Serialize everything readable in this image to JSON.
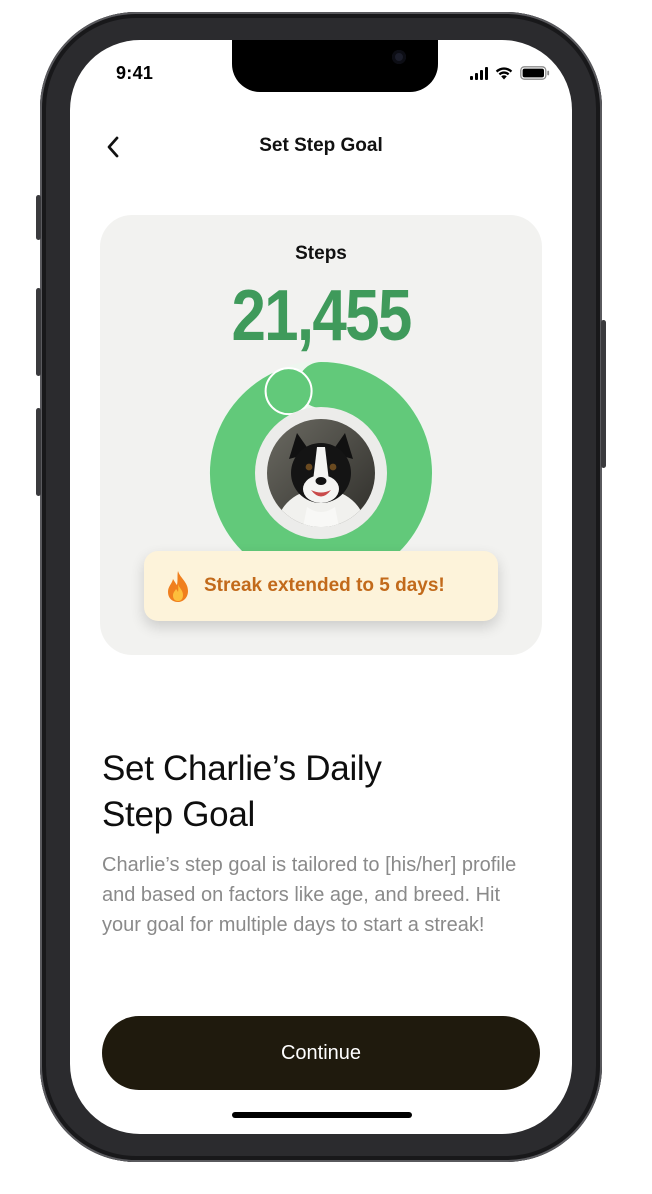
{
  "status_bar": {
    "time": "9:41"
  },
  "nav": {
    "title": "Set Step Goal",
    "back_icon": "chevron-left-icon"
  },
  "card": {
    "steps_label": "Steps",
    "steps_value": "21,455",
    "progress_fraction": 0.94,
    "avatar": "dog-photo",
    "streak_text": "Streak extended to 5 days!",
    "streak_icon": "flame-icon"
  },
  "content": {
    "heading_line1": "Set Charlie’s Daily",
    "heading_line2": "Step Goal",
    "description": "Charlie’s step goal is tailored to [his/her] profile and based on factors like age, and breed. Hit your goal for multiple days to start a streak!"
  },
  "cta": {
    "label": "Continue"
  },
  "colors": {
    "accent_green": "#3f9a5b",
    "ring_green": "#62c97a",
    "button_dark": "#1f1a0d",
    "streak_orange": "#c26a1b",
    "highlight_yellow": "#f5f037"
  }
}
